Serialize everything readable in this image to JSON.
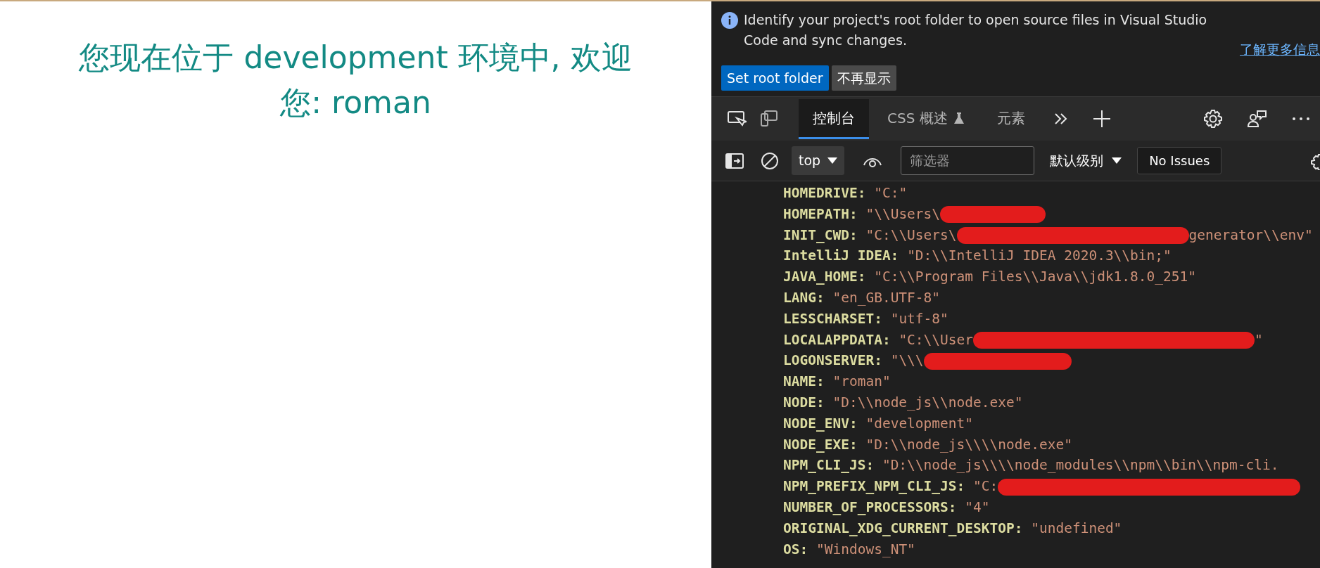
{
  "page": {
    "heading": "您现在位于 development 环境中, 欢迎您: roman"
  },
  "devtools": {
    "infobar": {
      "message": "Identify your project's root folder to open source files in Visual Studio Code and sync changes.",
      "link": "了解更多信息",
      "buttons": [
        {
          "label": "Set root folder",
          "kind": "primary"
        },
        {
          "label": "不再显示",
          "kind": "secondary"
        }
      ]
    },
    "tabs": [
      {
        "label": "控制台",
        "selected": true,
        "experimental": false
      },
      {
        "label": "CSS 概述",
        "selected": false,
        "experimental": true
      },
      {
        "label": "元素",
        "selected": false,
        "experimental": false
      }
    ],
    "toolbar": {
      "context": "top",
      "filter": {
        "placeholder": "筛选器"
      },
      "level": "默认级别",
      "issues": "No Issues"
    },
    "console_lines": [
      {
        "key": "HOMEDRIVE:",
        "value": "\"C:\"",
        "redacted": false
      },
      {
        "key": "HOMEPATH:",
        "value": "\"\\\\Users\\",
        "redacted": true
      },
      {
        "key": "INIT_CWD:",
        "value": "\"C:\\\\Users\\",
        "redacted": true,
        "value_after": "generator\\\\env\""
      },
      {
        "key": "IntelliJ IDEA:",
        "value": "\"D:\\\\IntelliJ IDEA 2020.3\\\\bin;\"",
        "redacted": false
      },
      {
        "key": "JAVA_HOME:",
        "value": "\"C:\\\\Program Files\\\\Java\\\\jdk1.8.0_251\"",
        "redacted": false
      },
      {
        "key": "LANG:",
        "value": "\"en_GB.UTF-8\"",
        "redacted": false
      },
      {
        "key": "LESSCHARSET:",
        "value": "\"utf-8\"",
        "redacted": false
      },
      {
        "key": "LOCALAPPDATA:",
        "value": "\"C:\\\\User",
        "redacted": true,
        "value_after": "\""
      },
      {
        "key": "LOGONSERVER:",
        "value": "\"\\\\\\",
        "redacted": true
      },
      {
        "key": "NAME:",
        "value": "\"roman\"",
        "redacted": false
      },
      {
        "key": "NODE:",
        "value": "\"D:\\\\node_js\\\\node.exe\"",
        "redacted": false
      },
      {
        "key": "NODE_ENV:",
        "value": "\"development\"",
        "redacted": false
      },
      {
        "key": "NODE_EXE:",
        "value": "\"D:\\\\node_js\\\\\\\\node.exe\"",
        "redacted": false
      },
      {
        "key": "NPM_CLI_JS:",
        "value": "\"D:\\\\node_js\\\\\\\\node_modules\\\\npm\\\\bin\\\\npm-cli.",
        "redacted": false
      },
      {
        "key": "NPM_PREFIX_NPM_CLI_JS:",
        "value": "\"C:",
        "redacted": true
      },
      {
        "key": "NUMBER_OF_PROCESSORS:",
        "value": "\"4\"",
        "redacted": false
      },
      {
        "key": "ORIGINAL_XDG_CURRENT_DESKTOP:",
        "value": "\"undefined\"",
        "redacted": false
      },
      {
        "key": "OS:",
        "value": "\"Windows_NT\"",
        "redacted": false
      }
    ]
  }
}
